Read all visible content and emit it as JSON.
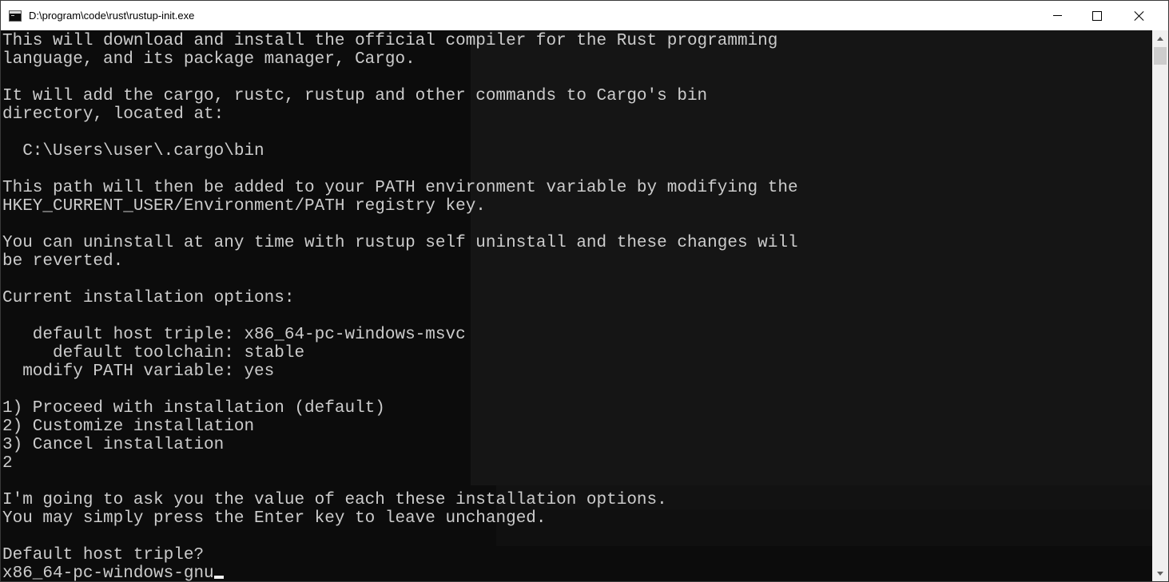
{
  "window": {
    "title": "D:\\program\\code\\rust\\rustup-init.exe",
    "icon": "console-icon",
    "controls": {
      "minimize": "minimize-icon",
      "maximize": "maximize-icon",
      "close": "close-icon"
    }
  },
  "console": {
    "lines": [
      "This will download and install the official compiler for the Rust programming",
      "language, and its package manager, Cargo.",
      "",
      "It will add the cargo, rustc, rustup and other commands to Cargo's bin",
      "directory, located at:",
      "",
      "  C:\\Users\\user\\.cargo\\bin",
      "",
      "This path will then be added to your PATH environment variable by modifying the",
      "HKEY_CURRENT_USER/Environment/PATH registry key.",
      "",
      "You can uninstall at any time with rustup self uninstall and these changes will",
      "be reverted.",
      "",
      "Current installation options:",
      "",
      "   default host triple: x86_64-pc-windows-msvc",
      "     default toolchain: stable",
      "  modify PATH variable: yes",
      "",
      "1) Proceed with installation (default)",
      "2) Customize installation",
      "3) Cancel installation",
      "2",
      "",
      "I'm going to ask you the value of each these installation options.",
      "You may simply press the Enter key to leave unchanged.",
      "",
      "Default host triple?"
    ],
    "input_value": "x86_64-pc-windows-gnu"
  },
  "colors": {
    "console_background": "#0c0c0c",
    "console_text": "#cccccc",
    "titlebar": "#ffffff",
    "scrollbar_track": "#f0f0f0",
    "scrollbar_thumb": "#cdcdcd"
  }
}
